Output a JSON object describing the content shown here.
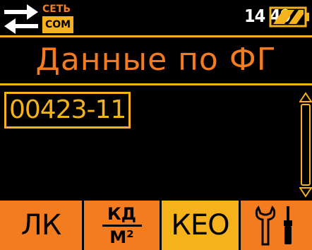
{
  "status_bar": {
    "connection": {
      "line1": "СЕТЬ",
      "line2": "COM",
      "icon": "exchange-arrows-icon"
    },
    "clock": "14 49",
    "battery_icon": "battery-icon"
  },
  "title": "Данные по ФГ",
  "record_id": "00423-11",
  "scrollbar_icon": "scrollbar-icon",
  "function_keys": [
    {
      "label": "ЛК"
    },
    {
      "numerator": "КД",
      "denominator": "М²"
    },
    {
      "label": "КЕО"
    },
    {
      "icon": "tools-icon"
    }
  ],
  "colors": {
    "orange": "#f47c20",
    "yellow": "#f6b21b",
    "background": "#000000"
  }
}
